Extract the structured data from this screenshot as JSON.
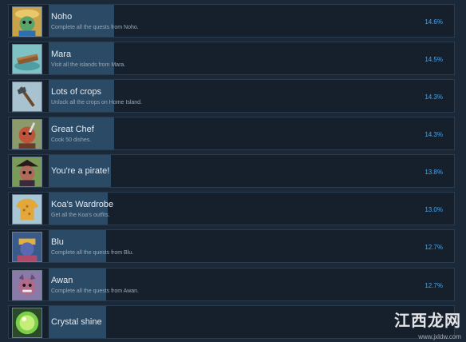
{
  "achievements": [
    {
      "title": "Noho",
      "description": "Complete all the quests from Noho.",
      "percent": "14.6%",
      "icon": "noho-character-icon",
      "fill": 0.146
    },
    {
      "title": "Mara",
      "description": "Visit all the islands from Mara.",
      "percent": "14.5%",
      "icon": "island-raft-icon",
      "fill": 0.145
    },
    {
      "title": "Lots of crops",
      "description": "Unlock all the crops on Home Island.",
      "percent": "14.3%",
      "icon": "hoe-icon",
      "fill": 0.143
    },
    {
      "title": "Great Chef",
      "description": "Cook 50 dishes.",
      "percent": "14.3%",
      "icon": "chef-character-icon",
      "fill": 0.143
    },
    {
      "title": "You're a pirate!",
      "description": "",
      "percent": "13.8%",
      "icon": "pirate-character-icon",
      "fill": 0.138
    },
    {
      "title": "Koa's Wardrobe",
      "description": "Get all the Koa's outfits.",
      "percent": "13.0%",
      "icon": "shirt-icon",
      "fill": 0.13
    },
    {
      "title": "Blu",
      "description": "Complete all the quests from Blu.",
      "percent": "12.7%",
      "icon": "blu-character-icon",
      "fill": 0.127
    },
    {
      "title": "Awan",
      "description": "Complete all the quests from Awan.",
      "percent": "12.7%",
      "icon": "awan-character-icon",
      "fill": 0.127
    },
    {
      "title": "Crystal shine",
      "description": "",
      "percent": "",
      "icon": "crystal-orb-icon",
      "fill": 0.125
    }
  ],
  "watermark": {
    "text": "江西龙网",
    "sub": "www.jxldw.com"
  }
}
